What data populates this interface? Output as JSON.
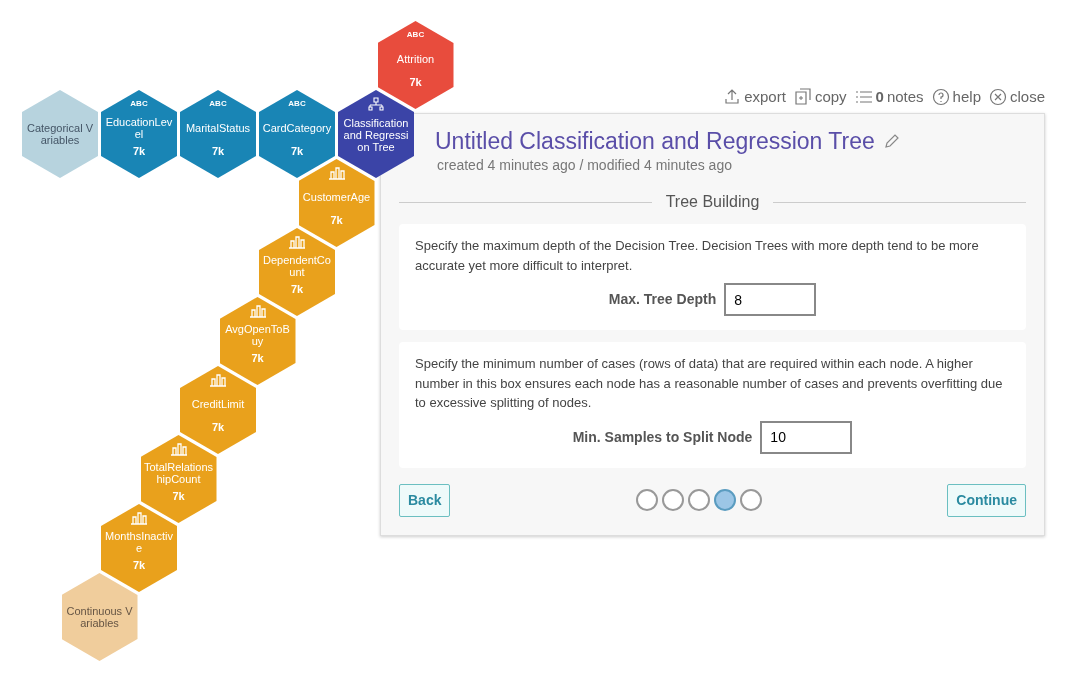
{
  "hexes": [
    {
      "kind": "group",
      "label": "Categorical Variables"
    },
    {
      "kind": "categorical",
      "type_label": "ABC",
      "label": "EducationLevel",
      "count": "7k"
    },
    {
      "kind": "categorical",
      "type_label": "ABC",
      "label": "MaritalStatus",
      "count": "7k"
    },
    {
      "kind": "categorical",
      "type_label": "ABC",
      "label": "CardCategory",
      "count": "7k"
    },
    {
      "kind": "model",
      "label": "Classification and Regression Tree"
    },
    {
      "kind": "target",
      "type_label": "ABC",
      "label": "Attrition",
      "count": "7k"
    },
    {
      "kind": "numeric",
      "label": "CustomerAge",
      "count": "7k"
    },
    {
      "kind": "numeric",
      "label": "DependentCount",
      "count": "7k"
    },
    {
      "kind": "numeric",
      "label": "AvgOpenToBuy",
      "count": "7k"
    },
    {
      "kind": "numeric",
      "label": "CreditLimit",
      "count": "7k"
    },
    {
      "kind": "numeric",
      "label": "TotalRelationshipCount",
      "count": "7k"
    },
    {
      "kind": "numeric",
      "label": "MonthsInactive",
      "count": "7k"
    },
    {
      "kind": "group2",
      "label": "Continuous Variables"
    }
  ],
  "toolbar": [
    {
      "kind": "export",
      "label": "export"
    },
    {
      "kind": "copy",
      "label": "copy"
    },
    {
      "kind": "notes",
      "count": "0",
      "label": "notes"
    },
    {
      "kind": "help",
      "label": "help"
    },
    {
      "kind": "close",
      "label": "close"
    }
  ],
  "panel": {
    "title": "Untitled Classification and Regression Tree",
    "meta": "created 4 minutes ago / modified 4 minutes ago",
    "section": "Tree Building",
    "settings": [
      {
        "description": "Specify the maximum depth of the Decision Tree. Decision Trees with more depth tend to be more accurate yet more difficult to interpret.",
        "label": "Max. Tree Depth",
        "value": "8"
      },
      {
        "description": "Specify the minimum number of cases (rows of data) that are required within each node. A higher number in this box ensures each node has a reasonable number of cases and prevents overfitting due to excessive splitting of nodes.",
        "label": "Min. Samples to Split Node",
        "value": "10"
      }
    ],
    "back": "Back",
    "continue": "Continue",
    "steps": [
      {
        "selected": false
      },
      {
        "selected": false
      },
      {
        "selected": false
      },
      {
        "selected": true
      },
      {
        "selected": false
      }
    ]
  }
}
